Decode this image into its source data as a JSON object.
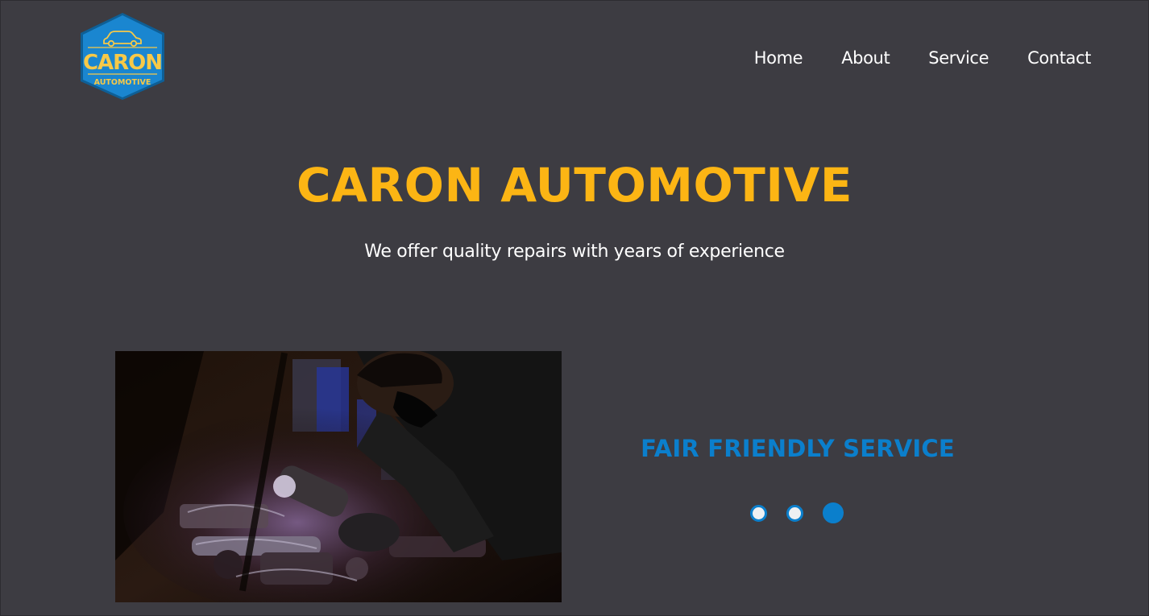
{
  "brand": {
    "logo_main": "CARON",
    "logo_sub": "AUTOMOTIVE",
    "logo_icon": "car-icon",
    "colors": {
      "badge_blue": "#1a86d0",
      "badge_border": "#0e5f96",
      "logo_yellow": "#f7c948"
    }
  },
  "nav": {
    "items": [
      {
        "label": "Home"
      },
      {
        "label": "About"
      },
      {
        "label": "Service"
      },
      {
        "label": "Contact"
      }
    ]
  },
  "hero": {
    "title": "CARON AUTOMOTIVE",
    "subtitle": "We offer quality repairs with years of experience"
  },
  "slider": {
    "image_icon": "mechanic-engine-photo",
    "caption": "FAIR FRIENDLY SERVICE",
    "total_slides": 3,
    "active_slide": 3
  },
  "colors": {
    "background": "#3d3c42",
    "accent_yellow": "#fcb514",
    "accent_blue": "#0b7fcc",
    "text_white": "#ffffff",
    "dot_inactive": "#eef0f2"
  }
}
